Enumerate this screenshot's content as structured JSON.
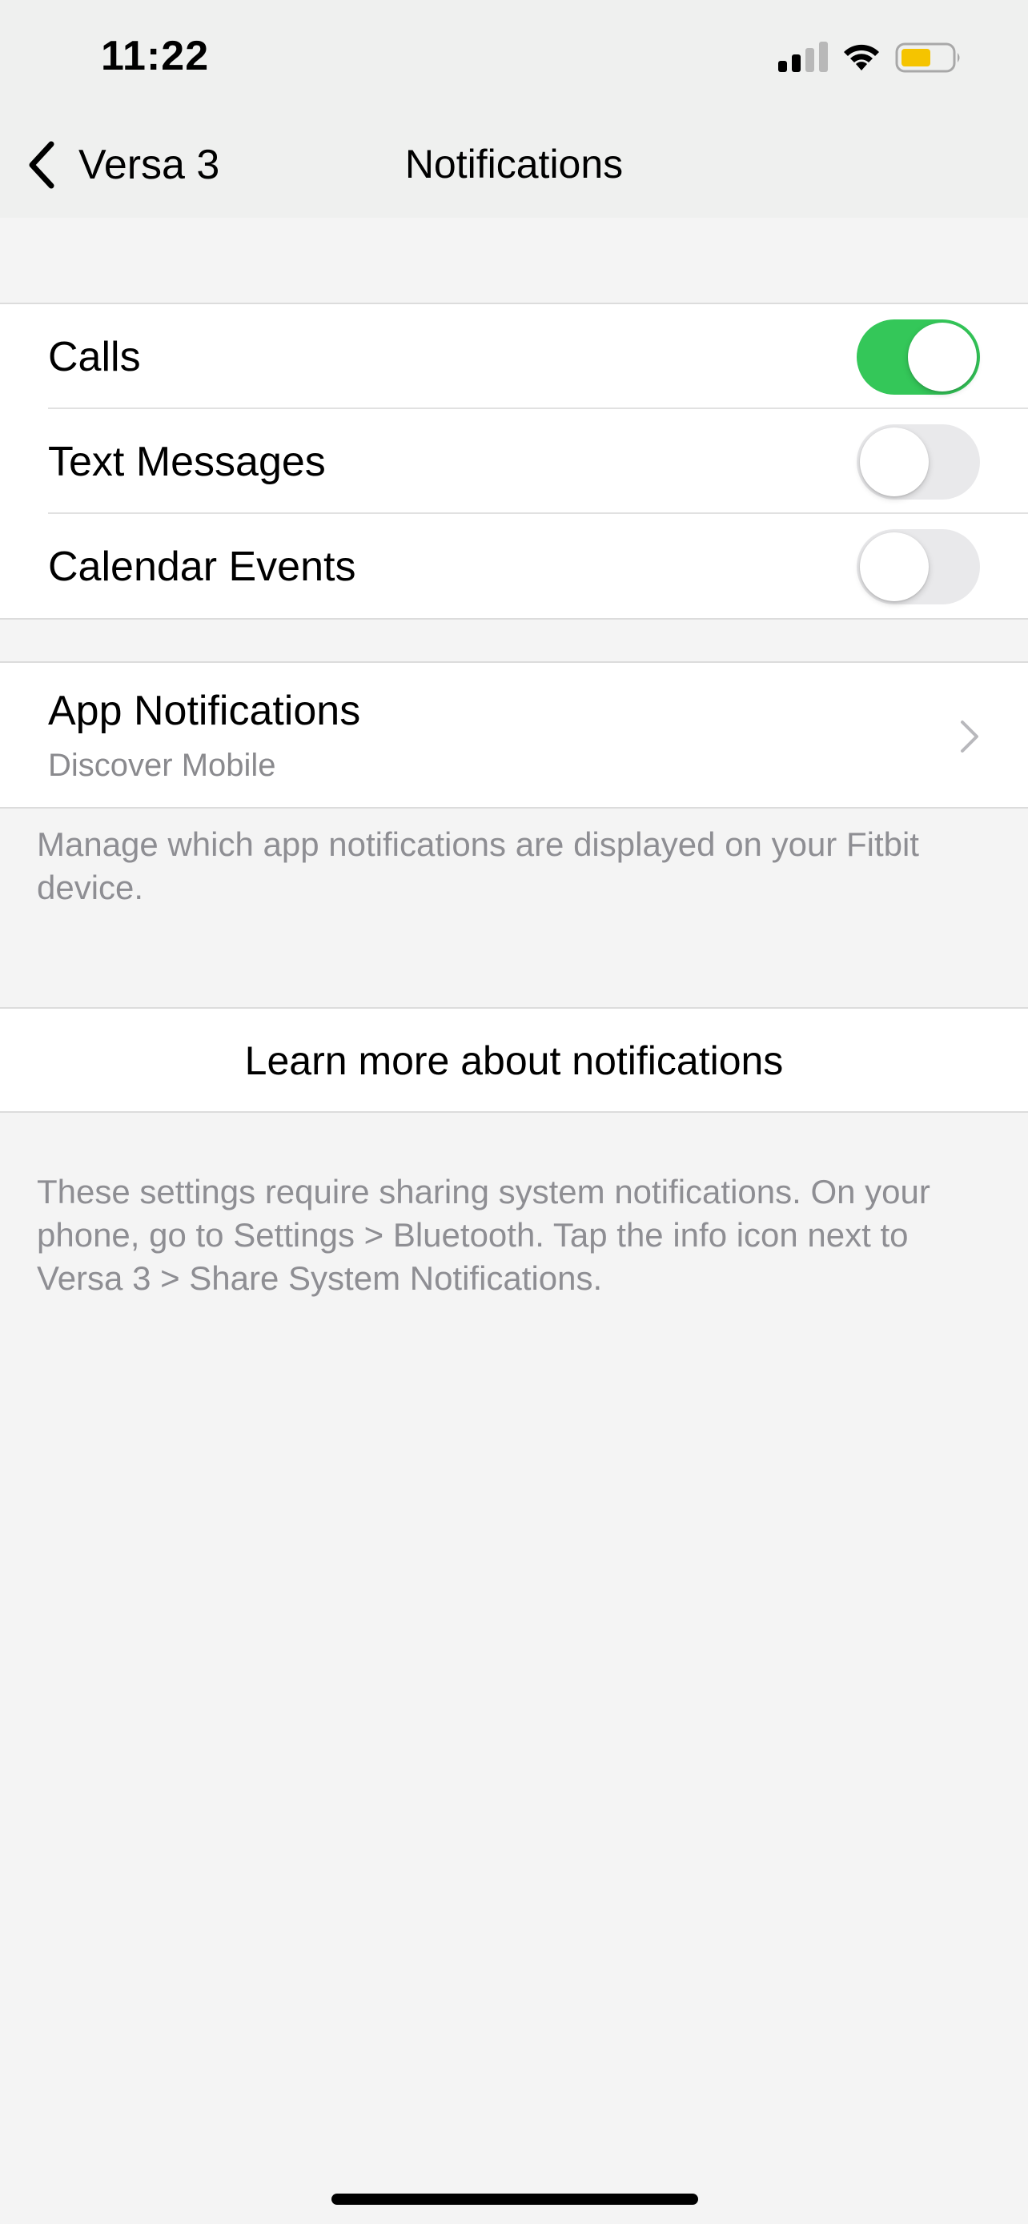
{
  "status_bar": {
    "time": "11:22",
    "signal_icon": "cellular-signal-icon",
    "wifi_icon": "wifi-icon",
    "battery_icon": "battery-icon",
    "battery_color": "#f5c400"
  },
  "nav": {
    "back_label": "Versa 3",
    "title": "Notifications",
    "back_icon": "chevron-left-icon"
  },
  "toggles": [
    {
      "label": "Calls",
      "on": true
    },
    {
      "label": "Text Messages",
      "on": false
    },
    {
      "label": "Calendar Events",
      "on": false
    }
  ],
  "app_notifications": {
    "title": "App Notifications",
    "subtitle": "Discover Mobile",
    "chevron_icon": "chevron-right-icon"
  },
  "app_notifications_footnote": "Manage which app notifications are displayed on your Fitbit device.",
  "learn_more": {
    "label": "Learn more about notifications"
  },
  "settings_footnote": "These settings require sharing system notifications. On your phone, go to Settings > Bluetooth. Tap the info icon next to Versa 3 > Share System Notifications.",
  "colors": {
    "toggle_on": "#34c759",
    "toggle_off": "#e9e9eb",
    "secondary_text": "#8e8e93"
  }
}
